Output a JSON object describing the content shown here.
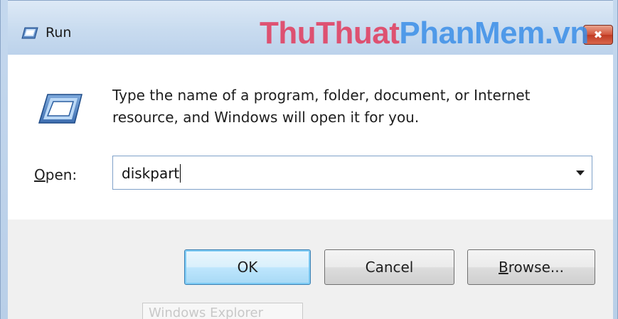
{
  "window": {
    "title": "Run",
    "close_glyph": "✖",
    "watermark_part1": "ThuThuat",
    "watermark_part2": "PhanMem.vn"
  },
  "dialog": {
    "description": "Type the name of a program, folder, document, or Internet resource, and Windows will open it for you.",
    "open_label_mnemonic": "O",
    "open_label_rest": "pen:",
    "open_value": "diskpart",
    "run_icon": "run-icon"
  },
  "buttons": {
    "ok": "OK",
    "cancel": "Cancel",
    "browse_mnemonic": "B",
    "browse_rest": "rowse..."
  },
  "taskbar_tooltip": "Windows Explorer",
  "colors": {
    "close_red": "#c03a22",
    "default_button_blue": "#3c7fb1",
    "watermark_red": "#e23a5c",
    "watermark_blue": "#3b8fe8"
  }
}
